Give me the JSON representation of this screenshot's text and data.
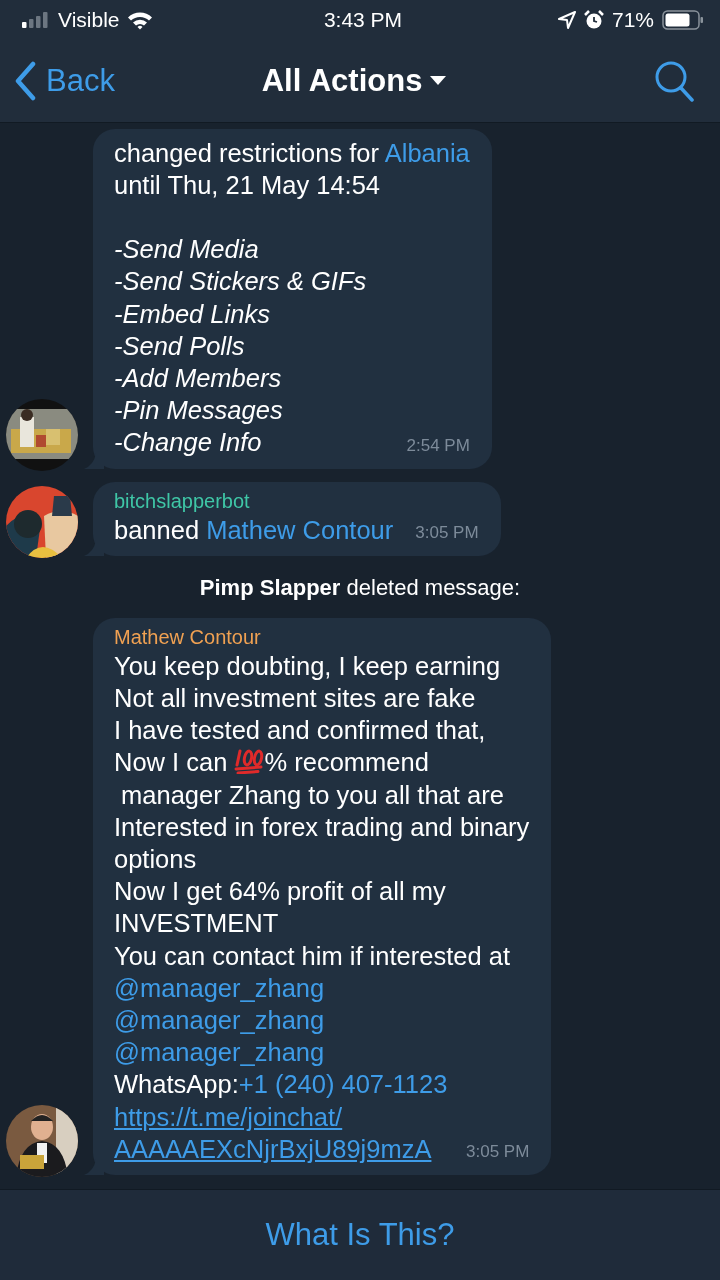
{
  "status_bar": {
    "carrier": "Visible",
    "time": "3:43 PM",
    "battery": "71%"
  },
  "nav": {
    "back": "Back",
    "title": "All Actions"
  },
  "messages": [
    {
      "kind": "bubble",
      "avatar": {
        "kind": "picture"
      },
      "time": "2:54 PM",
      "paragraphs": [
        [
          [
            {
              "kind": "text",
              "text": "changed restrictions for "
            },
            {
              "kind": "link",
              "text": "Albania"
            }
          ],
          [
            {
              "kind": "text",
              "text": "until Thu, 21 May 14:54"
            }
          ]
        ],
        [
          [
            {
              "kind": "italic",
              "text": "-Send Media"
            }
          ],
          [
            {
              "kind": "italic",
              "text": "-Send Stickers & GIFs"
            }
          ],
          [
            {
              "kind": "italic",
              "text": "-Embed Links"
            }
          ],
          [
            {
              "kind": "italic",
              "text": "-Send Polls"
            }
          ],
          [
            {
              "kind": "italic",
              "text": "-Add Members"
            }
          ],
          [
            {
              "kind": "italic",
              "text": "-Pin Messages"
            }
          ],
          [
            {
              "kind": "italic",
              "text": "-Change Info"
            }
          ]
        ]
      ]
    },
    {
      "kind": "bubble",
      "avatar": {
        "kind": "picture"
      },
      "sender": {
        "name": "bitchslapperbot",
        "color": "#3fc6a6"
      },
      "time": "3:05 PM",
      "paragraphs": [
        [
          [
            {
              "kind": "text",
              "text": "banned "
            },
            {
              "kind": "link",
              "text": "Mathew Contour"
            }
          ]
        ]
      ]
    },
    {
      "kind": "service",
      "text": "**Pimp Slapper** deleted message:"
    },
    {
      "kind": "bubble",
      "avatar": {
        "kind": "picture"
      },
      "sender": {
        "name": "Mathew Contour",
        "color": "#f0a152"
      },
      "time": "3:05 PM",
      "paragraphs": [
        [
          [
            {
              "kind": "text",
              "text": "You keep doubting, I keep earning"
            }
          ],
          [
            {
              "kind": "text",
              "text": "Not all investment sites are fake"
            }
          ],
          [
            {
              "kind": "text",
              "text": "I have tested and confirmed that,"
            }
          ],
          [
            {
              "kind": "text",
              "text": "Now I can "
            },
            {
              "kind": "emoji"
            },
            {
              "kind": "text",
              "text": "% recommend"
            }
          ],
          [
            {
              "kind": "text",
              "text": " manager Zhang to you all that are"
            }
          ],
          [
            {
              "kind": "text",
              "text": "Interested in forex trading and binary"
            }
          ],
          [
            {
              "kind": "text",
              "text": "options"
            }
          ],
          [
            {
              "kind": "text",
              "text": "Now I get 64% profit of all my"
            }
          ],
          [
            {
              "kind": "text",
              "text": "INVESTMENT"
            }
          ],
          [
            {
              "kind": "text",
              "text": "You can contact him if interested at"
            }
          ],
          [
            {
              "kind": "link",
              "text": "@manager_zhang"
            }
          ],
          [
            {
              "kind": "link",
              "text": "@manager_zhang"
            }
          ],
          [
            {
              "kind": "link",
              "text": "@manager_zhang"
            }
          ],
          [
            {
              "kind": "text",
              "text": "WhatsApp:"
            },
            {
              "kind": "link",
              "text": "+1 (240) 407-1123"
            }
          ],
          [
            {
              "kind": "url",
              "text": "https://t.me/joinchat/"
            }
          ],
          [
            {
              "kind": "url",
              "text": "AAAAAEXcNjrBxjU89j9mzA"
            }
          ]
        ]
      ]
    }
  ],
  "bottom_button": "What Is This?"
}
